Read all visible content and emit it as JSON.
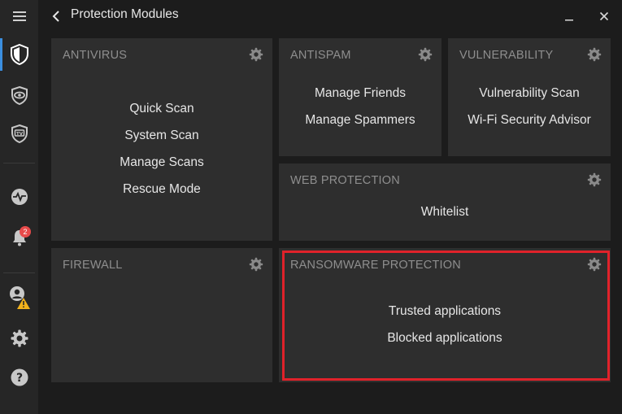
{
  "header": {
    "title": "Protection Modules"
  },
  "sidebar": {
    "items": [
      {
        "name": "menu-icon"
      },
      {
        "name": "shield-icon",
        "active": true
      },
      {
        "name": "eye-icon"
      },
      {
        "name": "tv-shield-icon"
      },
      {
        "name": "activity-icon"
      },
      {
        "name": "bell-icon",
        "badge": "2"
      },
      {
        "name": "user-warning-icon"
      },
      {
        "name": "gear-icon"
      },
      {
        "name": "help-icon"
      }
    ],
    "notifications_badge": "2"
  },
  "modules": {
    "antivirus": {
      "title": "ANTIVIRUS",
      "links": [
        "Quick Scan",
        "System Scan",
        "Manage Scans",
        "Rescue Mode"
      ]
    },
    "antispam": {
      "title": "ANTISPAM",
      "links": [
        "Manage Friends",
        "Manage Spammers"
      ]
    },
    "vulnerability": {
      "title": "VULNERABILITY",
      "links": [
        "Vulnerability Scan",
        "Wi-Fi Security Advisor"
      ]
    },
    "web_protection": {
      "title": "WEB PROTECTION",
      "links": [
        "Whitelist"
      ]
    },
    "firewall": {
      "title": "FIREWALL",
      "links": []
    },
    "ransomware": {
      "title": "RANSOMWARE PROTECTION",
      "links": [
        "Trusted applications",
        "Blocked applications"
      ]
    }
  },
  "colors": {
    "background": "#1c1c1c",
    "sidebar": "#262626",
    "card": "#2e2e2e",
    "accent": "#3b8fe0",
    "badge": "#e84b4b",
    "highlight": "#e0222a",
    "warning": "#f2b21c"
  }
}
